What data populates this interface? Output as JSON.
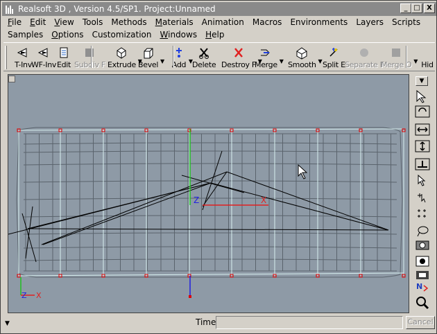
{
  "window": {
    "title": "Realsoft 3D , Version 4.5/SP1. Project:Unnamed",
    "minimize_glyph": "_",
    "maximize_glyph": "□",
    "close_glyph": "X"
  },
  "menu": {
    "row1": [
      {
        "label": "File",
        "underline": "F",
        "rest": "ile"
      },
      {
        "label": "Edit",
        "underline": "E",
        "rest": "dit"
      },
      {
        "label": "View",
        "underline": "V",
        "rest": "iew"
      },
      {
        "label": "Tools",
        "underline": "",
        "rest": "Tools"
      },
      {
        "label": "Methods",
        "underline": "",
        "rest": "Methods"
      },
      {
        "label": "Materials",
        "underline": "M",
        "rest": "aterials"
      },
      {
        "label": "Animation",
        "underline": "",
        "rest": "Animation"
      },
      {
        "label": "Macros",
        "underline": "",
        "rest": "Macros"
      },
      {
        "label": "Environments",
        "underline": "",
        "rest": "Environments"
      },
      {
        "label": "Layers",
        "underline": "",
        "rest": "Layers"
      },
      {
        "label": "Scripts",
        "underline": "",
        "rest": "Scripts"
      }
    ],
    "row2": [
      {
        "label": "Samples",
        "underline": "",
        "rest": "Samples"
      },
      {
        "label": "Options",
        "underline": "O",
        "rest": "ptions"
      },
      {
        "label": "Customization",
        "underline": "",
        "rest": "Customization"
      },
      {
        "label": "Windows",
        "underline": "W",
        "rest": "indows"
      },
      {
        "label": "Help",
        "underline": "H",
        "rest": "elp"
      }
    ]
  },
  "toolbar": {
    "tools": [
      {
        "label": "T-Inv",
        "icon": "t-inv-icon",
        "disabled": false
      },
      {
        "label": "WF-Inv",
        "icon": "wf-inv-icon",
        "disabled": false
      },
      {
        "label": "Edit",
        "icon": "edit-icon",
        "disabled": false
      },
      {
        "label": "Subdiv F",
        "icon": "subdiv-icon",
        "disabled": true
      },
      {
        "label": "Extrude",
        "icon": "extrude-icon",
        "disabled": false
      },
      {
        "label": "Bevel",
        "icon": "bevel-icon",
        "disabled": false
      },
      {
        "label": "Add",
        "icon": "add-icon",
        "disabled": false
      },
      {
        "label": "Delete",
        "icon": "delete-icon",
        "disabled": false
      },
      {
        "label": "Destroy F",
        "icon": "destroy-icon",
        "disabled": false
      },
      {
        "label": "Merge",
        "icon": "merge-icon",
        "disabled": false
      },
      {
        "label": "Smooth",
        "icon": "smooth-icon",
        "disabled": false
      },
      {
        "label": "Split E",
        "icon": "split-icon",
        "disabled": false
      },
      {
        "label": "Separate F",
        "icon": "separate-icon",
        "disabled": true
      },
      {
        "label": "Merge O",
        "icon": "merge-objects-icon",
        "disabled": true
      },
      {
        "label": "Hid",
        "icon": "hide-icon",
        "disabled": false
      }
    ]
  },
  "viewport": {
    "background": "#8e9aa6",
    "mesh_color": "#5a636c",
    "selected_color": "#d8f0f0",
    "point_color": "#e00000",
    "axis_x_label": "X",
    "axis_z_label": "Z",
    "axis_x_color": "#e02020",
    "axis_y_color": "#20c020",
    "axis_z_color": "#2020e0"
  },
  "right_tools": [
    {
      "icon": "select-arrow-icon"
    },
    {
      "icon": "rotate-view-icon"
    },
    {
      "icon": "scale-horizontal-icon"
    },
    {
      "icon": "scale-vertical-icon"
    },
    {
      "icon": "move-view-icon"
    },
    {
      "icon": "pointer-icon"
    },
    {
      "icon": "add-point-icon"
    },
    {
      "icon": "multi-point-icon"
    },
    {
      "icon": "lasso-icon"
    },
    {
      "icon": "camera-icon"
    },
    {
      "icon": "light-icon"
    },
    {
      "icon": "render-icon"
    },
    {
      "icon": "navigation-icon"
    },
    {
      "icon": "zoom-icon"
    }
  ],
  "status": {
    "time_label": "Time:",
    "time_value": "",
    "cancel_label": "Cancel"
  }
}
